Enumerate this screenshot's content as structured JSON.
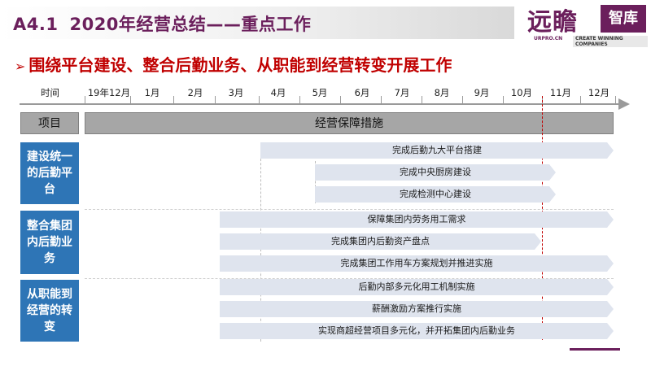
{
  "header": {
    "section_num": "A4.1",
    "title": "2020年经营总结——重点工作"
  },
  "logo": {
    "cn_name": "远瞻",
    "box_text": "智库",
    "url": "URPRO.CN",
    "slogan": "CREATE WINNING COMPANIES"
  },
  "subtitle": "围绕平台建设、整合后勤业务、从职能到经营转变开展工作",
  "timeline": {
    "time_label": "时间",
    "months": [
      "19年12月",
      "1月",
      "2月",
      "3月",
      "4月",
      "5月",
      "6月",
      "7月",
      "8月",
      "9月",
      "10月",
      "11月",
      "12月"
    ]
  },
  "table_header": {
    "item_label": "项目",
    "measures_label": "经营保障措施"
  },
  "categories": [
    {
      "label": "建设统一的后勤平台",
      "tasks": [
        "完成后勤九大平台搭建",
        "完成中央厨房建设",
        "完成检测中心建设"
      ]
    },
    {
      "label": "整合集团内后勤业务",
      "tasks": [
        "保障集团内劳务用工需求",
        "完成集团内后勤资产盘点",
        "完成集团工作用车方案规划并推进实施"
      ]
    },
    {
      "label": "从职能到经营的转变",
      "tasks": [
        "后勤内部多元化用工机制实施",
        "薪酬激励方案推行实施",
        "实现商超经营项目多元化，并开拓集团内后勤业务"
      ]
    }
  ],
  "colors": {
    "brand": "#6b1f5c",
    "accent_red": "#c00000",
    "category_blue": "#2e75b6",
    "bar_fill": "#dfe4ee"
  }
}
